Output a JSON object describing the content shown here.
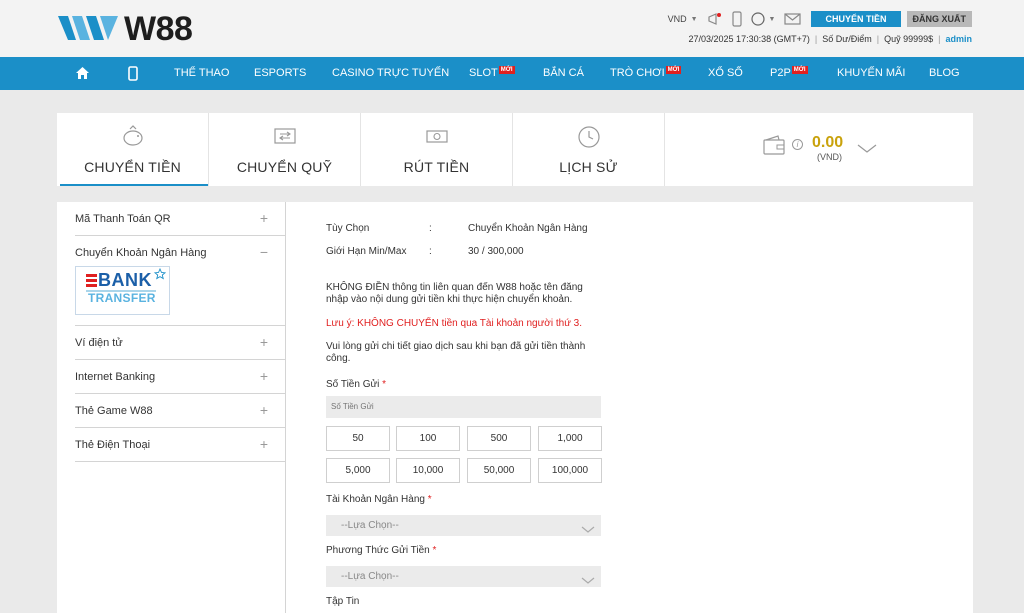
{
  "brand": {
    "name": "W88"
  },
  "header": {
    "currency": "VND",
    "transfer_button": "CHUYỂN TIỀN",
    "logout_button": "ĐĂNG XUẤT",
    "datetime": "27/03/2025 17:30:38 (GMT+7)",
    "balance_label": "Số Dư/Điểm",
    "fund_label": "Quỹ 99999$",
    "username": "admin"
  },
  "nav": {
    "items": [
      {
        "label": "THỂ THAO"
      },
      {
        "label": "ESPORTS"
      },
      {
        "label": "CASINO TRỰC TUYẾN"
      },
      {
        "label": "SLOT",
        "badge": "MỚI"
      },
      {
        "label": "BẮN CÁ"
      },
      {
        "label": "TRÒ CHƠI",
        "badge": "MỚI"
      },
      {
        "label": "XỔ SỐ"
      },
      {
        "label": "P2P",
        "badge": "MỚI"
      },
      {
        "label": "KHUYẾN MÃI"
      },
      {
        "label": "BLOG"
      }
    ]
  },
  "tabs": [
    {
      "label": "CHUYỂN TIỀN",
      "icon": "piggy-bank-icon",
      "active": true
    },
    {
      "label": "CHUYỂN QUỸ",
      "icon": "transfer-icon"
    },
    {
      "label": "RÚT TIỀN",
      "icon": "cash-icon"
    },
    {
      "label": "LỊCH SỬ",
      "icon": "history-icon"
    }
  ],
  "wallet": {
    "amount": "0.00",
    "currency": "(VND)"
  },
  "sidebar": {
    "items": [
      {
        "label": "Mã Thanh Toán QR",
        "toggle": "+"
      },
      {
        "label": "Chuyển Khoản Ngân Hàng",
        "toggle": "−"
      },
      {
        "label": "Ví điện tử",
        "toggle": "+"
      },
      {
        "label": "Internet Banking",
        "toggle": "+"
      },
      {
        "label": "Thẻ Game W88",
        "toggle": "+"
      },
      {
        "label": "Thẻ Điện Thoại",
        "toggle": "+"
      }
    ],
    "bank_logo_line1": "BANK",
    "bank_logo_line2": "TRANSFER"
  },
  "form": {
    "option_label": "Tùy Chọn",
    "option_value": "Chuyển Khoản Ngân Hàng",
    "limit_label": "Giới Hạn Min/Max",
    "limit_value": "30 / 300,000",
    "colon": ":",
    "notice": "KHÔNG ĐIỀN thông tin liên quan đến W88 hoặc tên đăng nhập vào nội dung gửi tiền khi thực hiện chuyển khoản.",
    "warning": "Lưu ý: KHÔNG CHUYỂN tiền qua Tài khoản người thứ 3.",
    "instruction": "Vui lòng gửi chi tiết giao dịch sau khi bạn đã gửi tiền thành công.",
    "amount_label": "Số Tiền Gửi",
    "amount_placeholder": "Số Tiền Gửi",
    "quick_amounts": [
      "50",
      "100",
      "500",
      "1,000",
      "5,000",
      "10,000",
      "50,000",
      "100,000"
    ],
    "bank_account_label": "Tài Khoản Ngân Hàng",
    "bank_account_select": "--Lựa Chọn--",
    "method_label": "Phương Thức Gửi Tiền",
    "method_select": "--Lựa Chọn--",
    "file_label": "Tập Tin",
    "required_mark": "*"
  }
}
